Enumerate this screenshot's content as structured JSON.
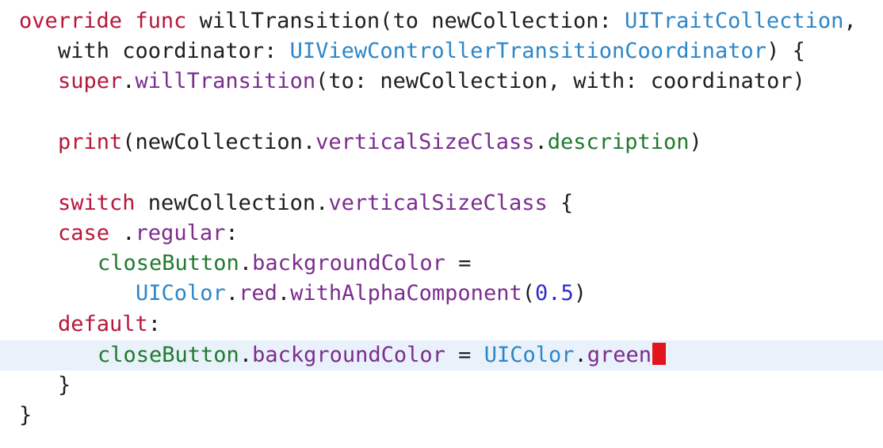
{
  "colors": {
    "keyword": "#b8173a",
    "type": "#2e86c7",
    "member": "#7b2d8f",
    "method": "#1f7a2e",
    "number": "#2f2ccf",
    "plain": "#1f1f1f",
    "current_line_highlight": "#e9f1fa",
    "cursor": "#e3141b"
  },
  "code": {
    "l1": {
      "kw_override": "override",
      "kw_func": "func",
      "name": "willTransition(to newCollection: ",
      "type": "UITraitCollection",
      "comma": ","
    },
    "l2": {
      "with": "with coordinator: ",
      "type": "UIViewControllerTransitionCoordinator",
      "rest": ") {"
    },
    "l3": {
      "kw_super": "super",
      "dot": ".",
      "method": "willTransition",
      "rest": "(to: newCollection, with: coordinator)"
    },
    "l5": {
      "fn": "print",
      "open": "(newCollection.",
      "member": "verticalSizeClass",
      "dot": ".",
      "prop": "description",
      "close": ")"
    },
    "l7": {
      "kw_switch": "switch",
      "text": " newCollection.",
      "member": "verticalSizeClass",
      "rest": " {"
    },
    "l8": {
      "kw_case": "case",
      "text": " .",
      "value": "regular",
      "colon": ":"
    },
    "l9": {
      "var": "closeButton",
      "dot": ".",
      "member": "backgroundColor",
      "rest": " ="
    },
    "l10": {
      "type": "UIColor",
      "dot1": ".",
      "member": "red",
      "dot2": ".",
      "method": "withAlphaComponent",
      "open": "(",
      "num": "0.5",
      "close": ")"
    },
    "l11": {
      "kw_default": "default",
      "colon": ":"
    },
    "l12": {
      "var": "closeButton",
      "dot": ".",
      "member": "backgroundColor",
      "eq": " = ",
      "type": "UIColor",
      "dot2": ".",
      "value": "green"
    },
    "l13": {
      "brace": "}"
    },
    "l14": {
      "brace": "}"
    }
  }
}
